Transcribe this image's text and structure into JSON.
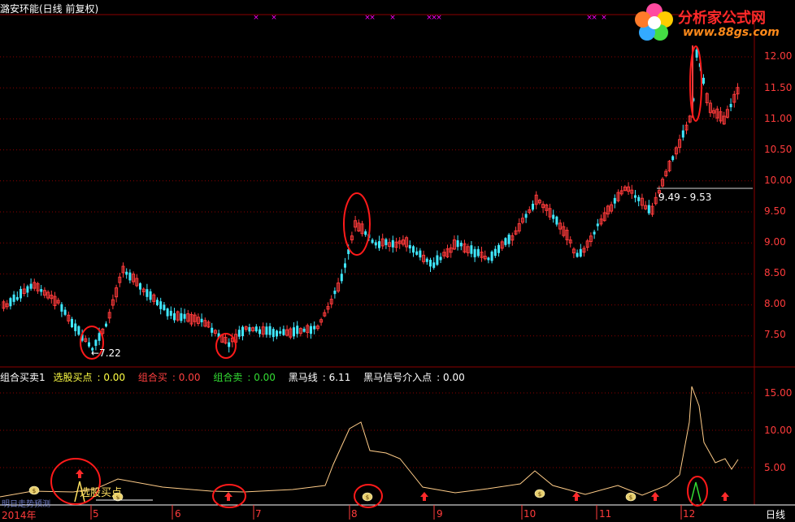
{
  "title": "潞安环能(日线 前复权)",
  "logo": {
    "name": "分析家公式网",
    "url": "www.88gs.com"
  },
  "price_axis": [
    "12.00",
    "11.50",
    "11.00",
    "10.50",
    "10.00",
    "9.50",
    "9.00",
    "8.50",
    "8.00",
    "7.50"
  ],
  "indicator_axis": [
    "15.00",
    "10.00",
    "5.00"
  ],
  "x_labels": [
    "2014年",
    "5",
    "6",
    "7",
    "8",
    "9",
    "10",
    "11",
    "12"
  ],
  "period_tab": "日线",
  "annotations": {
    "low_label": "←7.22",
    "range_label": "9.49 - 9.53",
    "select_label": "选股买点"
  },
  "indicator_line": {
    "name": "组合买卖1",
    "items": [
      {
        "label": "选股买点",
        "value": "0.00"
      },
      {
        "label": "组合买",
        "value": "0.00"
      },
      {
        "label": "组合卖",
        "value": "0.00"
      },
      {
        "label": "黑马线",
        "value": "6.11"
      },
      {
        "label": "黑马信号介入点",
        "value": "0.00"
      }
    ]
  },
  "bottom_legend": "明日走势预测",
  "colors": {
    "up": "#ff3b3b",
    "down": "#40e8ff",
    "grid": "#8b0000",
    "line": "#ffcc88",
    "accent": "#ff00ff"
  }
}
